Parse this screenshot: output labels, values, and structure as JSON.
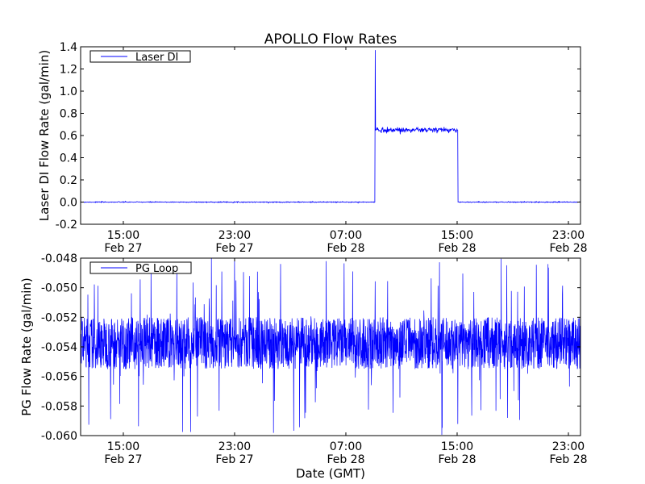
{
  "chart_data": [
    {
      "type": "line",
      "title": "APOLLO Flow Rates",
      "xlabel": "",
      "ylabel": "Laser DI Flow Rate (gal/min)",
      "x_units": "hours since 15:00 Feb 27 (GMT)",
      "xlim": [
        -3.07,
        32.87
      ],
      "ylim": [
        -0.2,
        1.4
      ],
      "yticks": [
        "-0.2",
        "0.0",
        "0.2",
        "0.4",
        "0.6",
        "0.8",
        "1.0",
        "1.2",
        "1.4"
      ],
      "ytick_values": [
        -0.2,
        0,
        0.2,
        0.4,
        0.6,
        0.8,
        1.0,
        1.2,
        1.4
      ],
      "xticks": [
        {
          "v": 0,
          "l1": "15:00",
          "l2": "Feb 27"
        },
        {
          "v": 8,
          "l1": "23:00",
          "l2": "Feb 27"
        },
        {
          "v": 16,
          "l1": "07:00",
          "l2": "Feb 28"
        },
        {
          "v": 24,
          "l1": "15:00",
          "l2": "Feb 28"
        },
        {
          "v": 32,
          "l1": "23:00",
          "l2": "Feb 28"
        }
      ],
      "legend": {
        "label": "Laser DI",
        "position": "top-left"
      },
      "series": [
        {
          "name": "Laser DI",
          "color": "#0000ff",
          "baseline": 0.0,
          "step_on": 18.1,
          "spike": 1.37,
          "plateau": 0.65,
          "plateau_noise": 0.02,
          "step_off": 24.05
        }
      ]
    },
    {
      "type": "line",
      "xlabel": "Date (GMT)",
      "ylabel": "PG Flow Rate (gal/min)",
      "x_units": "hours since 15:00 Feb 27 (GMT)",
      "xlim": [
        -3.07,
        32.87
      ],
      "ylim": [
        -0.06,
        -0.048
      ],
      "yticks": [
        "-0.060",
        "-0.058",
        "-0.056",
        "-0.054",
        "-0.052",
        "-0.050",
        "-0.048"
      ],
      "ytick_values": [
        -0.06,
        -0.058,
        -0.056,
        -0.054,
        -0.052,
        -0.05,
        -0.048
      ],
      "xticks": [
        {
          "v": 0,
          "l1": "15:00",
          "l2": "Feb 27"
        },
        {
          "v": 8,
          "l1": "23:00",
          "l2": "Feb 27"
        },
        {
          "v": 16,
          "l1": "07:00",
          "l2": "Feb 28"
        },
        {
          "v": 24,
          "l1": "15:00",
          "l2": "Feb 28"
        },
        {
          "v": 32,
          "l1": "23:00",
          "l2": "Feb 28"
        }
      ],
      "legend": {
        "label": "PG Loop",
        "position": "top-left"
      },
      "series": [
        {
          "name": "PG Loop",
          "color": "#0000ff",
          "mean": -0.054,
          "band": [
            -0.0555,
            -0.052
          ],
          "min": -0.06,
          "max": -0.048
        }
      ]
    }
  ]
}
